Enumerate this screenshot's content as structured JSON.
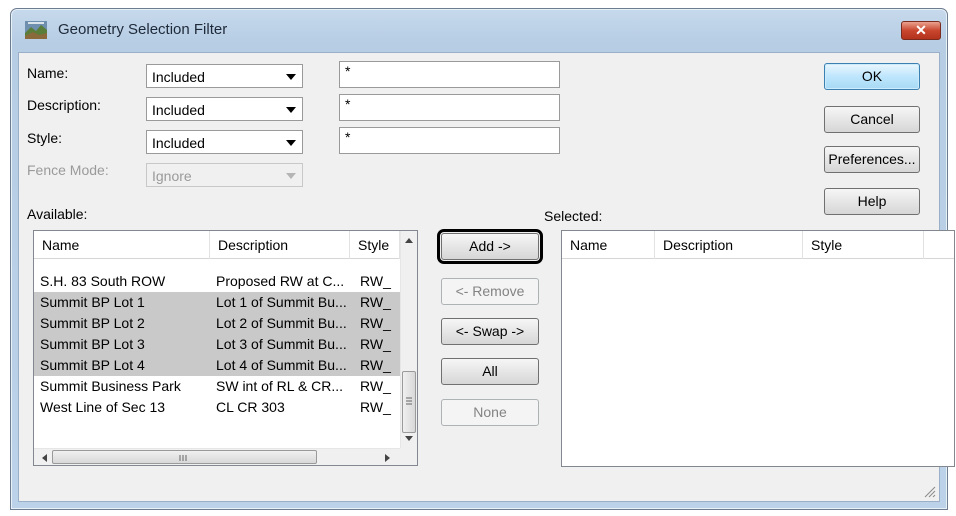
{
  "window": {
    "title": "Geometry Selection Filter",
    "close_glyph": "✕"
  },
  "filters": {
    "name": {
      "label": "Name:",
      "mode": "Included",
      "pattern": "*"
    },
    "description": {
      "label": "Description:",
      "mode": "Included",
      "pattern": "*"
    },
    "style": {
      "label": "Style:",
      "mode": "Included",
      "pattern": "*"
    },
    "fence_mode": {
      "label": "Fence Mode:",
      "value": "Ignore"
    }
  },
  "buttons": {
    "ok": "OK",
    "cancel": "Cancel",
    "preferences": "Preferences...",
    "help": "Help",
    "add": "Add ->",
    "remove": "<- Remove",
    "swap": "<- Swap ->",
    "all": "All",
    "none": "None"
  },
  "available": {
    "label": "Available:",
    "columns": [
      "Name",
      "Description",
      "Style"
    ],
    "rows": [
      {
        "name": "S.H. 83 South ROW",
        "description": "Proposed RW at C...",
        "style": "RW_",
        "selected": false
      },
      {
        "name": "Summit BP Lot 1",
        "description": "Lot 1 of Summit Bu...",
        "style": "RW_",
        "selected": true
      },
      {
        "name": "Summit BP Lot 2",
        "description": "Lot 2 of Summit Bu...",
        "style": "RW_",
        "selected": true
      },
      {
        "name": "Summit BP Lot 3",
        "description": "Lot 3 of Summit Bu...",
        "style": "RW_",
        "selected": true
      },
      {
        "name": "Summit BP Lot 4",
        "description": "Lot 4 of Summit Bu...",
        "style": "RW_",
        "selected": true
      },
      {
        "name": "Summit Business Park",
        "description": "SW int of RL & CR...",
        "style": "RW_",
        "selected": false
      },
      {
        "name": "West Line of Sec 13",
        "description": "CL CR 303",
        "style": "RW_",
        "selected": false
      }
    ]
  },
  "selected": {
    "label": "Selected:",
    "columns": [
      "Name",
      "Description",
      "Style"
    ],
    "rows": []
  }
}
